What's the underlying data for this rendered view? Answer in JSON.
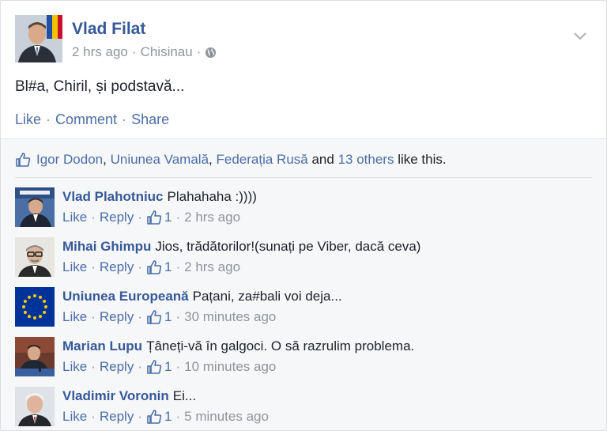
{
  "post": {
    "author": "Vlad Filat",
    "time": "2 hrs ago",
    "location": "Chisinau",
    "text": "Bl#a, Chiril, și podstavă...",
    "actions": {
      "like": "Like",
      "comment": "Comment",
      "share": "Share"
    },
    "privacy_icon": "globe-icon"
  },
  "likes": {
    "names": [
      "Igor Dodon",
      "Uniunea Vamală",
      "Federația Rusă"
    ],
    "sep1": ",",
    "sep2": ",",
    "and": "and",
    "others": "13 others",
    "suffix": "like this."
  },
  "comments": [
    {
      "name": "Vlad Plahotniuc",
      "text": "Plahahaha :))))",
      "like": "Like",
      "reply": "Reply",
      "count": "1",
      "time": "2 hrs ago"
    },
    {
      "name": "Mihai Ghimpu",
      "text": "Jios, trădătorilor!(sunați pe Viber, dacă ceva)",
      "like": "Like",
      "reply": "Reply",
      "count": "1",
      "time": "2 hrs ago"
    },
    {
      "name": "Uniunea Europeană",
      "text": "Pațani, za#bali voi deja...",
      "like": "Like",
      "reply": "Reply",
      "count": "1",
      "time": "30 minutes ago"
    },
    {
      "name": "Marian Lupu",
      "text": "Țâneți-vă în galgoci. O să razrulim problema.",
      "like": "Like",
      "reply": "Reply",
      "count": "1",
      "time": "10 minutes ago"
    },
    {
      "name": "Vladimir Voronin",
      "text": "Ei...",
      "like": "Like",
      "reply": "Reply",
      "count": "1",
      "time": "5 minutes ago"
    }
  ],
  "colors": {
    "link": "#365899",
    "action": "#4b6ea9",
    "meta": "#90949c",
    "text": "#1d2129",
    "eu_flag": "#003399",
    "eu_stars": "#ffcc00"
  }
}
